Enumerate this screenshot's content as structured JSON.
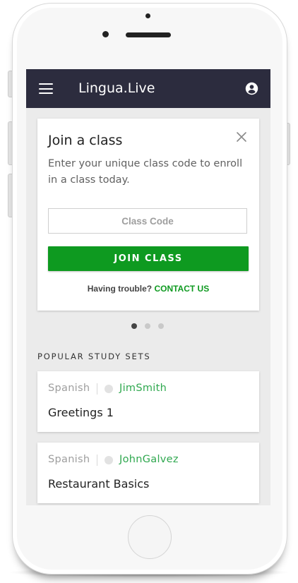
{
  "app": {
    "title": "Lingua.Live"
  },
  "icons": {
    "menu": "hamburger-icon",
    "account": "account-circle-icon",
    "close": "close-icon"
  },
  "colors": {
    "appbar": "#2c2c3e",
    "accent": "#0e9a20",
    "author": "#2fa84f"
  },
  "join_card": {
    "title": "Join a class",
    "description": "Enter your unique class code to enroll in a class today.",
    "input": {
      "placeholder": "Class Code",
      "value": ""
    },
    "button_label": "JOIN CLASS",
    "trouble_text": "Having trouble?",
    "contact_label": "CONTACT US"
  },
  "carousel": {
    "count": 3,
    "active": 1
  },
  "popular": {
    "heading": "POPULAR STUDY SETS",
    "sets": [
      {
        "language": "Spanish",
        "author": "JimSmith",
        "title": "Greetings 1"
      },
      {
        "language": "Spanish",
        "author": "JohnGalvez",
        "title": "Restaurant Basics"
      }
    ]
  }
}
